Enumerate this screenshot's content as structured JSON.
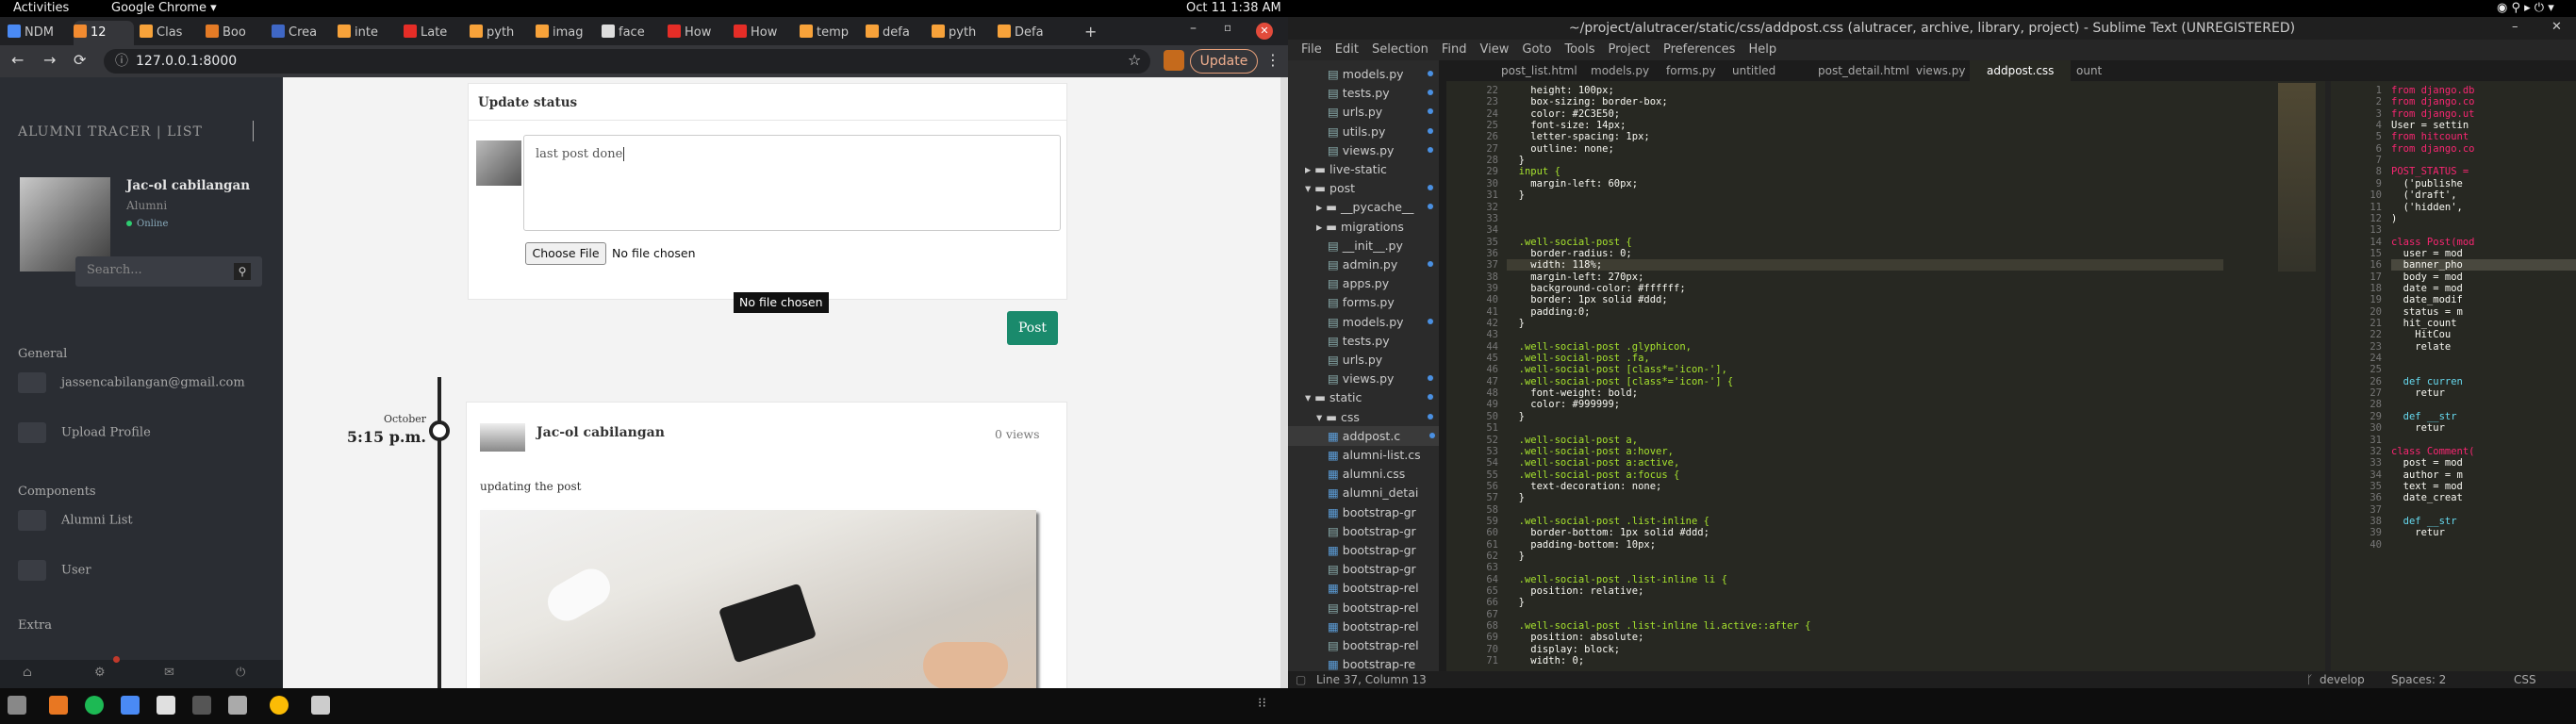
{
  "gnome": {
    "activities": "Activities",
    "app": "Google Chrome ▾",
    "clock": "Oct 11  1:38 AM"
  },
  "chrome": {
    "tabs": [
      {
        "label": "NDM",
        "color": "#4a8af4"
      },
      {
        "label": "12",
        "color": "#f28b30"
      },
      {
        "label": "Clas",
        "color": "#f7a23a"
      },
      {
        "label": "Boo",
        "color": "#e47b26"
      },
      {
        "label": "Crea",
        "color": "#3f67c5"
      },
      {
        "label": "inte",
        "color": "#f7a23a"
      },
      {
        "label": "Late",
        "color": "#e52d27"
      },
      {
        "label": "pyth",
        "color": "#f7a23a"
      },
      {
        "label": "imag",
        "color": "#f7a23a"
      },
      {
        "label": "face",
        "color": "#ddd"
      },
      {
        "label": "How",
        "color": "#e52d27"
      },
      {
        "label": "How",
        "color": "#e52d27"
      },
      {
        "label": "temp",
        "color": "#f7a23a"
      },
      {
        "label": "defa",
        "color": "#f7a23a"
      },
      {
        "label": "pyth",
        "color": "#f7a23a"
      },
      {
        "label": "Defa",
        "color": "#f7a23a"
      }
    ],
    "url": "127.0.0.1:8000",
    "update_label": "Update"
  },
  "app": {
    "brand": "ALUMNI TRACER | LIST",
    "profile_name": "Jac-ol cabilangan",
    "profile_role": "Alumni",
    "status": "Online",
    "search_placeholder": "Search...",
    "sections": {
      "general": "General",
      "components": "Components",
      "extra": "Extra"
    },
    "menu": {
      "email": "jassencabilangan@gmail.com",
      "upload": "Upload Profile",
      "alumni_list": "Alumni List",
      "user": "User"
    },
    "update_status": {
      "title": "Update status",
      "textarea_value": "last post done",
      "choose_file": "Choose File",
      "no_file": "No file chosen",
      "tooltip": "No file chosen",
      "post_button": "Post"
    },
    "post": {
      "month": "October",
      "time": "5:15 p.m.",
      "author": "Jac-ol cabilangan",
      "views": "0 views",
      "text": "updating the post"
    }
  },
  "sublime": {
    "title": "~/project/alutracer/static/css/addpost.css (alutracer, archive, library, project) - Sublime Text (UNREGISTERED)",
    "menu": [
      "File",
      "Edit",
      "Selection",
      "Find",
      "View",
      "Goto",
      "Tools",
      "Project",
      "Preferences",
      "Help"
    ],
    "tree": [
      {
        "label": "models.py",
        "indent": 2,
        "kind": "file",
        "dot": true
      },
      {
        "label": "tests.py",
        "indent": 2,
        "kind": "file",
        "dot": true
      },
      {
        "label": "urls.py",
        "indent": 2,
        "kind": "file",
        "dot": true
      },
      {
        "label": "utils.py",
        "indent": 2,
        "kind": "file",
        "dot": true
      },
      {
        "label": "views.py",
        "indent": 2,
        "kind": "file",
        "dot": true
      },
      {
        "label": "live-static",
        "indent": 0,
        "kind": "folder-closed",
        "dot": false
      },
      {
        "label": "post",
        "indent": 0,
        "kind": "folder-open",
        "dot": true
      },
      {
        "label": "__pycache__",
        "indent": 1,
        "kind": "folder-closed",
        "dot": true
      },
      {
        "label": "migrations",
        "indent": 1,
        "kind": "folder-closed",
        "dot": false
      },
      {
        "label": "__init__.py",
        "indent": 2,
        "kind": "file",
        "dot": false
      },
      {
        "label": "admin.py",
        "indent": 2,
        "kind": "file",
        "dot": true
      },
      {
        "label": "apps.py",
        "indent": 2,
        "kind": "file",
        "dot": false
      },
      {
        "label": "forms.py",
        "indent": 2,
        "kind": "file",
        "dot": false
      },
      {
        "label": "models.py",
        "indent": 2,
        "kind": "file",
        "dot": true
      },
      {
        "label": "tests.py",
        "indent": 2,
        "kind": "file",
        "dot": false
      },
      {
        "label": "urls.py",
        "indent": 2,
        "kind": "file",
        "dot": false
      },
      {
        "label": "views.py",
        "indent": 2,
        "kind": "file",
        "dot": true
      },
      {
        "label": "static",
        "indent": 0,
        "kind": "folder-open",
        "dot": true
      },
      {
        "label": "css",
        "indent": 1,
        "kind": "folder-open",
        "dot": true
      },
      {
        "label": "addpost.c",
        "indent": 2,
        "kind": "css",
        "dot": true
      },
      {
        "label": "alumni-list.cs",
        "indent": 2,
        "kind": "css",
        "dot": false
      },
      {
        "label": "alumni.css",
        "indent": 2,
        "kind": "css",
        "dot": false
      },
      {
        "label": "alumni_detai",
        "indent": 2,
        "kind": "css",
        "dot": false
      },
      {
        "label": "bootstrap-gr",
        "indent": 2,
        "kind": "css",
        "dot": false
      },
      {
        "label": "bootstrap-gr",
        "indent": 2,
        "kind": "file",
        "dot": false
      },
      {
        "label": "bootstrap-gr",
        "indent": 2,
        "kind": "css",
        "dot": false
      },
      {
        "label": "bootstrap-gr",
        "indent": 2,
        "kind": "file",
        "dot": false
      },
      {
        "label": "bootstrap-rel",
        "indent": 2,
        "kind": "css",
        "dot": false
      },
      {
        "label": "bootstrap-rel",
        "indent": 2,
        "kind": "file",
        "dot": false
      },
      {
        "label": "bootstrap-rel",
        "indent": 2,
        "kind": "css",
        "dot": false
      },
      {
        "label": "bootstrap-rel",
        "indent": 2,
        "kind": "file",
        "dot": false
      },
      {
        "label": "bootstrap-re",
        "indent": 2,
        "kind": "css",
        "dot": false
      }
    ],
    "tabs": [
      "post_list.html",
      "models.py",
      "forms.py",
      "untitled",
      "post_detail.html",
      "views.py",
      "addpost.css",
      "ount"
    ],
    "code_lines": [
      {
        "n": "22",
        "t": "    height: 100px;"
      },
      {
        "n": "23",
        "t": "    box-sizing: border-box;"
      },
      {
        "n": "24",
        "t": "    color: #2C3E50;"
      },
      {
        "n": "25",
        "t": "    font-size: 14px;"
      },
      {
        "n": "26",
        "t": "    letter-spacing: 1px;"
      },
      {
        "n": "27",
        "t": "    outline: none;"
      },
      {
        "n": "28",
        "t": "  }"
      },
      {
        "n": "29",
        "t": "  input {"
      },
      {
        "n": "30",
        "t": "    margin-left: 60px;"
      },
      {
        "n": "31",
        "t": "  }"
      },
      {
        "n": "32",
        "t": ""
      },
      {
        "n": "33",
        "t": ""
      },
      {
        "n": "34",
        "t": ""
      },
      {
        "n": "35",
        "t": "  .well-social-post {"
      },
      {
        "n": "36",
        "t": "    border-radius: 0;"
      },
      {
        "n": "37",
        "t": "    width: 118%;"
      },
      {
        "n": "38",
        "t": "    margin-left: 270px;"
      },
      {
        "n": "39",
        "t": "    background-color: #ffffff;"
      },
      {
        "n": "40",
        "t": "    border: 1px solid #ddd;"
      },
      {
        "n": "41",
        "t": "    padding:0;"
      },
      {
        "n": "42",
        "t": "  }"
      },
      {
        "n": "43",
        "t": ""
      },
      {
        "n": "44",
        "t": "  .well-social-post .glyphicon,"
      },
      {
        "n": "45",
        "t": "  .well-social-post .fa,"
      },
      {
        "n": "46",
        "t": "  .well-social-post [class*='icon-'],"
      },
      {
        "n": "47",
        "t": "  .well-social-post [class*='icon-'] {"
      },
      {
        "n": "48",
        "t": "    font-weight: bold;"
      },
      {
        "n": "49",
        "t": "    color: #999999;"
      },
      {
        "n": "50",
        "t": "  }"
      },
      {
        "n": "51",
        "t": ""
      },
      {
        "n": "52",
        "t": "  .well-social-post a,"
      },
      {
        "n": "53",
        "t": "  .well-social-post a:hover,"
      },
      {
        "n": "54",
        "t": "  .well-social-post a:active,"
      },
      {
        "n": "55",
        "t": "  .well-social-post a:focus {"
      },
      {
        "n": "56",
        "t": "    text-decoration: none;"
      },
      {
        "n": "57",
        "t": "  }"
      },
      {
        "n": "58",
        "t": ""
      },
      {
        "n": "59",
        "t": "  .well-social-post .list-inline {"
      },
      {
        "n": "60",
        "t": "    border-bottom: 1px solid #ddd;"
      },
      {
        "n": "61",
        "t": "    padding-bottom: 10px;"
      },
      {
        "n": "62",
        "t": "  }"
      },
      {
        "n": "63",
        "t": ""
      },
      {
        "n": "64",
        "t": "  .well-social-post .list-inline li {"
      },
      {
        "n": "65",
        "t": "    position: relative;"
      },
      {
        "n": "66",
        "t": "  }"
      },
      {
        "n": "67",
        "t": ""
      },
      {
        "n": "68",
        "t": "  .well-social-post .list-inline li.active::after {"
      },
      {
        "n": "69",
        "t": "    position: absolute;"
      },
      {
        "n": "70",
        "t": "    display: block;"
      },
      {
        "n": "71",
        "t": "    width: 0;"
      }
    ],
    "right_code": [
      {
        "n": "1",
        "t": "from django.db"
      },
      {
        "n": "2",
        "t": "from django.co"
      },
      {
        "n": "3",
        "t": "from django.ut"
      },
      {
        "n": "4",
        "t": "User = settin"
      },
      {
        "n": "5",
        "t": "from hitcount"
      },
      {
        "n": "6",
        "t": "from django.co"
      },
      {
        "n": "7",
        "t": ""
      },
      {
        "n": "8",
        "t": "POST_STATUS ="
      },
      {
        "n": "9",
        "t": "  ('publishe"
      },
      {
        "n": "10",
        "t": "  ('draft',"
      },
      {
        "n": "11",
        "t": "  ('hidden',"
      },
      {
        "n": "12",
        "t": ")"
      },
      {
        "n": "13",
        "t": ""
      },
      {
        "n": "14",
        "t": "class Post(mod"
      },
      {
        "n": "15",
        "t": "  user = mod"
      },
      {
        "n": "16",
        "t": "  banner_pho"
      },
      {
        "n": "17",
        "t": "  body = mod"
      },
      {
        "n": "18",
        "t": "  date = mod"
      },
      {
        "n": "19",
        "t": "  date_modif"
      },
      {
        "n": "20",
        "t": "  status = m"
      },
      {
        "n": "21",
        "t": "  hit_count"
      },
      {
        "n": "22",
        "t": "    HitCou"
      },
      {
        "n": "23",
        "t": "    relate"
      },
      {
        "n": "24",
        "t": ""
      },
      {
        "n": "25",
        "t": ""
      },
      {
        "n": "26",
        "t": "  def curren"
      },
      {
        "n": "27",
        "t": "    retur"
      },
      {
        "n": "28",
        "t": ""
      },
      {
        "n": "29",
        "t": "  def __str"
      },
      {
        "n": "30",
        "t": "    retur"
      },
      {
        "n": "31",
        "t": ""
      },
      {
        "n": "32",
        "t": "class Comment("
      },
      {
        "n": "33",
        "t": "  post = mod"
      },
      {
        "n": "34",
        "t": "  author = m"
      },
      {
        "n": "35",
        "t": "  text = mod"
      },
      {
        "n": "36",
        "t": "  date_creat"
      },
      {
        "n": "37",
        "t": ""
      },
      {
        "n": "38",
        "t": "  def __str"
      },
      {
        "n": "39",
        "t": "    retur"
      },
      {
        "n": "40",
        "t": ""
      }
    ],
    "status_left": "Line 37, Column 13",
    "status_branch": "develop",
    "status_spaces": "Spaces: 2",
    "status_syntax": "CSS"
  }
}
